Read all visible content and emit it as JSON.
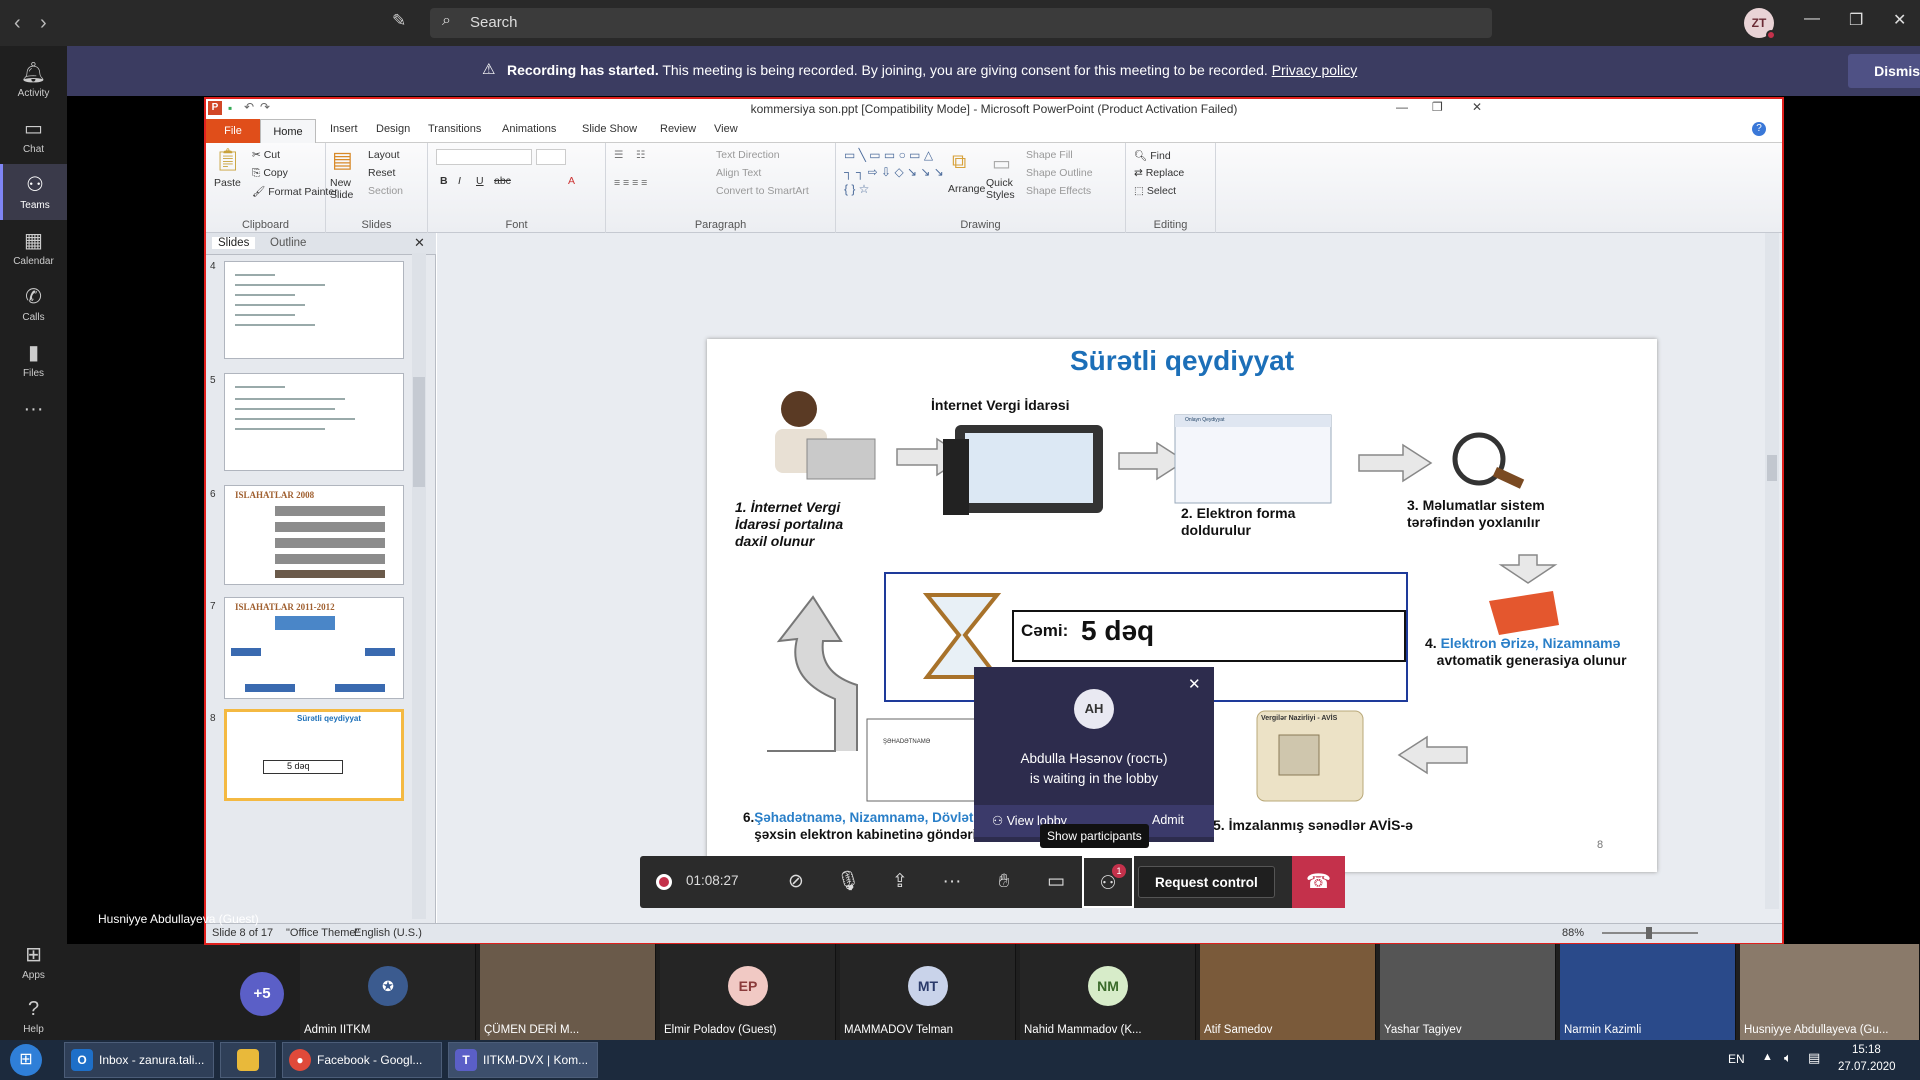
{
  "topbar": {
    "search_placeholder": "Search",
    "avatar_initials": "ZT"
  },
  "rail": [
    {
      "label": "Activity",
      "icon": "bell-icon"
    },
    {
      "label": "Chat",
      "icon": "chat-icon"
    },
    {
      "label": "Teams",
      "icon": "teams-icon"
    },
    {
      "label": "Calendar",
      "icon": "calendar-icon"
    },
    {
      "label": "Calls",
      "icon": "phone-icon"
    },
    {
      "label": "Files",
      "icon": "file-icon"
    },
    {
      "label": "Apps",
      "icon": "apps-icon"
    },
    {
      "label": "Help",
      "icon": "help-icon"
    }
  ],
  "banner": {
    "title": "Recording has started.",
    "message": " This meeting is being recorded. By joining, you are giving consent for this meeting to be recorded. ",
    "link": "Privacy policy",
    "dismiss": "Dismiss"
  },
  "ppt": {
    "window_title": "kommersiya son.ppt [Compatibility Mode] - Microsoft PowerPoint (Product Activation Failed)",
    "tabs": [
      "File",
      "Home",
      "Insert",
      "Design",
      "Transitions",
      "Animations",
      "Slide Show",
      "Review",
      "View"
    ],
    "groups": [
      "Clipboard",
      "Slides",
      "Font",
      "Paragraph",
      "Drawing",
      "Editing"
    ],
    "clipboard": {
      "paste": "Paste",
      "cut": "Cut",
      "copy": "Copy",
      "format_painter": "Format Painter"
    },
    "slides_grp": {
      "new_slide": "New Slide",
      "layout": "Layout",
      "reset": "Reset",
      "section": "Section"
    },
    "paragraph": {
      "text_direction": "Text Direction",
      "align_text": "Align Text",
      "smartart": "Convert to SmartArt"
    },
    "drawing": {
      "arrange": "Arrange",
      "quick_styles": "Quick Styles",
      "shape_fill": "Shape Fill",
      "shape_outline": "Shape Outline",
      "shape_effects": "Shape Effects"
    },
    "editing": {
      "find": "Find",
      "replace": "Replace",
      "select": "Select"
    },
    "pane_tabs": [
      "Slides",
      "Outline"
    ],
    "thumb_numbers": [
      "4",
      "5",
      "6",
      "7",
      "8"
    ],
    "thumb_titles": {
      "t6": "ISLAHATLAR 2008",
      "t7": "ISLAHATLAR 2011-2012",
      "t8": "Sürətli qeydiyyat",
      "t8_total": "5 dəq"
    },
    "status": {
      "slide": "Slide 8 of 17",
      "theme": "\"Office Theme\"",
      "lang": "English (U.S.)",
      "zoom": "88%"
    }
  },
  "slide": {
    "title": "Sürətli qeydiyyat",
    "net_label": "İnternet Vergi İdarəsi",
    "form_header": "Onlayn Qeydiyyat",
    "step1": "1. İnternet Vergi İdarəsi portalına daxil olunur",
    "step2": "2. Elektron forma doldurulur",
    "step3": "3. Məlumatlar sistem tərəfindən yoxlanılır",
    "step4_colored": "Elektron Ərizə,  Nizamnamə",
    "step4_num": "4.",
    "step4_rest": "avtomatik generasiya olunur",
    "step5": "5. İmzalanmış sənədlər AVİS-ə göndərilir",
    "step6_num": "6.",
    "step6_colored": "Şəhadətnamə, Nizamnamə, Dövlət reyestrindən",
    "step6_rest": "şəxsin elektron kabinetinə göndərilir",
    "total_label": "Cəmi:",
    "total_value": "5 dəq",
    "avis_label": "Vergilər Nazirliyi - AVİS",
    "certificate": "ŞƏHADƏTNAMƏ",
    "page_num": "8"
  },
  "popup": {
    "initials": "AH",
    "message_line1": "Abdulla Həsənov (гость)",
    "message_line2": "is waiting in the lobby",
    "view_lobby": "View lobby",
    "admit": "Admit"
  },
  "tooltip": "Show participants",
  "controls": {
    "timer": "01:08:27",
    "request_control": "Request control",
    "participants_badge": "1"
  },
  "presenter_name": "Husniyye Abdullayeva (Guest)",
  "participants": [
    {
      "name": "Admin IITKM",
      "initials": "",
      "color": "#3b5b8f"
    },
    {
      "name": "ÇÜMEN DERİ M...",
      "initials": "",
      "color": "#6a5a4a"
    },
    {
      "name": "Elmir Poladov (Guest)",
      "initials": "EP",
      "color": "#f1c9c4"
    },
    {
      "name": "MAMMADOV Telman",
      "initials": "MT",
      "color": "#c9d3ea"
    },
    {
      "name": "Nahid Mammadov (K...",
      "initials": "NM",
      "color": "#d7ecc9"
    },
    {
      "name": "Atif Samedov",
      "initials": "",
      "color": "#7a5a3a"
    },
    {
      "name": "Yashar Tagiyev",
      "initials": "",
      "color": "#555"
    },
    {
      "name": "Narmin Kazimli",
      "initials": "",
      "color": "#2a4a8a"
    },
    {
      "name": "Husniyye Abdullayeva (Gu...",
      "initials": "",
      "color": "#8a7a6a"
    }
  ],
  "more_count": "+5",
  "taskbar": {
    "tasks": [
      "Inbox - zanura.tali...",
      "Facebook - Googl...",
      "IITKM-DVX | Kom..."
    ],
    "lang": "EN",
    "time": "15:18",
    "date": "27.07.2020"
  }
}
